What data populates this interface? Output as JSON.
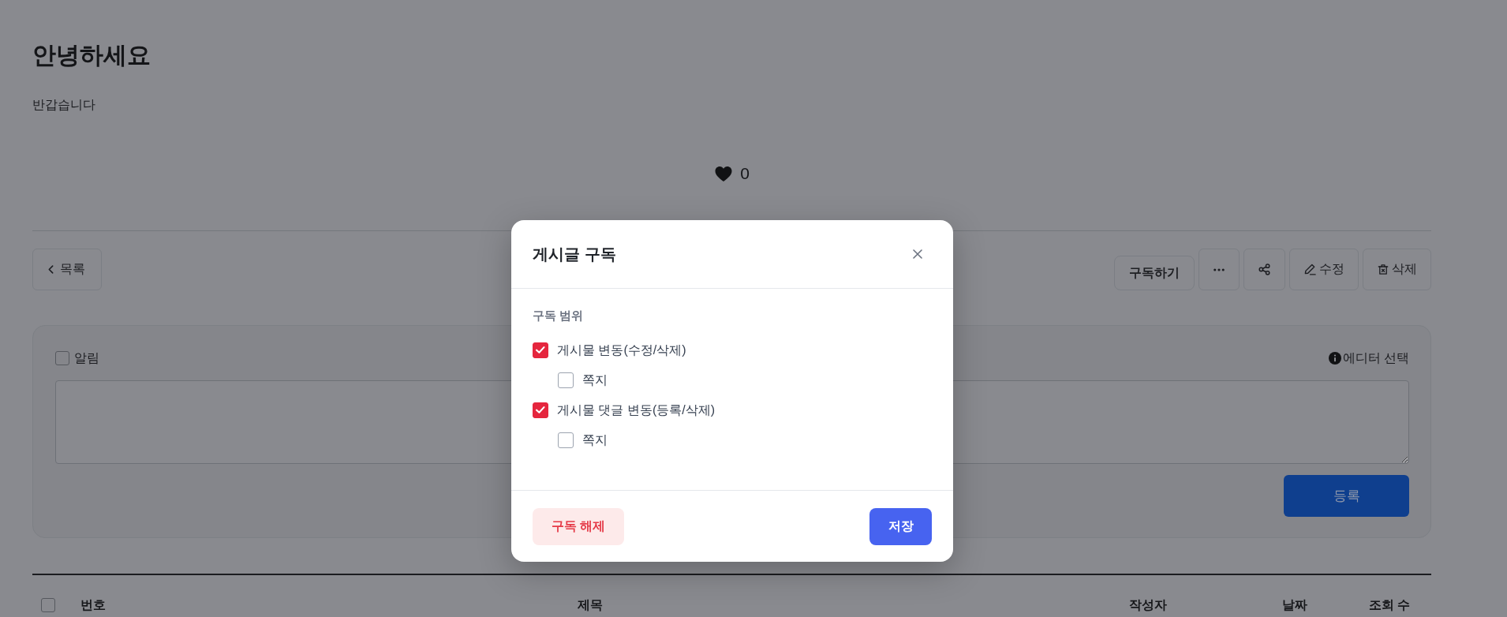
{
  "post": {
    "title": "안녕하세요",
    "body": "반갑습니다",
    "like_count": "0"
  },
  "toolbar": {
    "left": [
      {
        "kind": "back",
        "label": "목록"
      }
    ],
    "right": [
      {
        "kind": "subscribe",
        "label": "구독하기"
      },
      {
        "kind": "more"
      },
      {
        "kind": "share"
      },
      {
        "kind": "edit",
        "label": "수정"
      },
      {
        "kind": "delete",
        "label": "삭제"
      }
    ]
  },
  "comment_form": {
    "notify": {
      "label": "알림",
      "checked": false
    },
    "editor_select": "에디터 선택",
    "submit": "등록"
  },
  "table": {
    "select_all": {
      "checked": false
    },
    "columns": [
      "번호",
      "제목",
      "작성자",
      "날짜",
      "조회 수"
    ]
  },
  "modal": {
    "title": "게시글 구독",
    "section_label": "구독 범위",
    "options": [
      {
        "label": "게시물 변동(수정/삭제)",
        "checked": true,
        "children": [
          {
            "label": "쪽지",
            "checked": false
          }
        ]
      },
      {
        "label": "게시물 댓글 변동(등록/삭제)",
        "checked": true,
        "children": [
          {
            "label": "쪽지",
            "checked": false
          }
        ]
      }
    ],
    "buttons": [
      {
        "kind": "unsubscribe",
        "label": "구독 해제"
      },
      {
        "kind": "save",
        "label": "저장"
      }
    ]
  }
}
